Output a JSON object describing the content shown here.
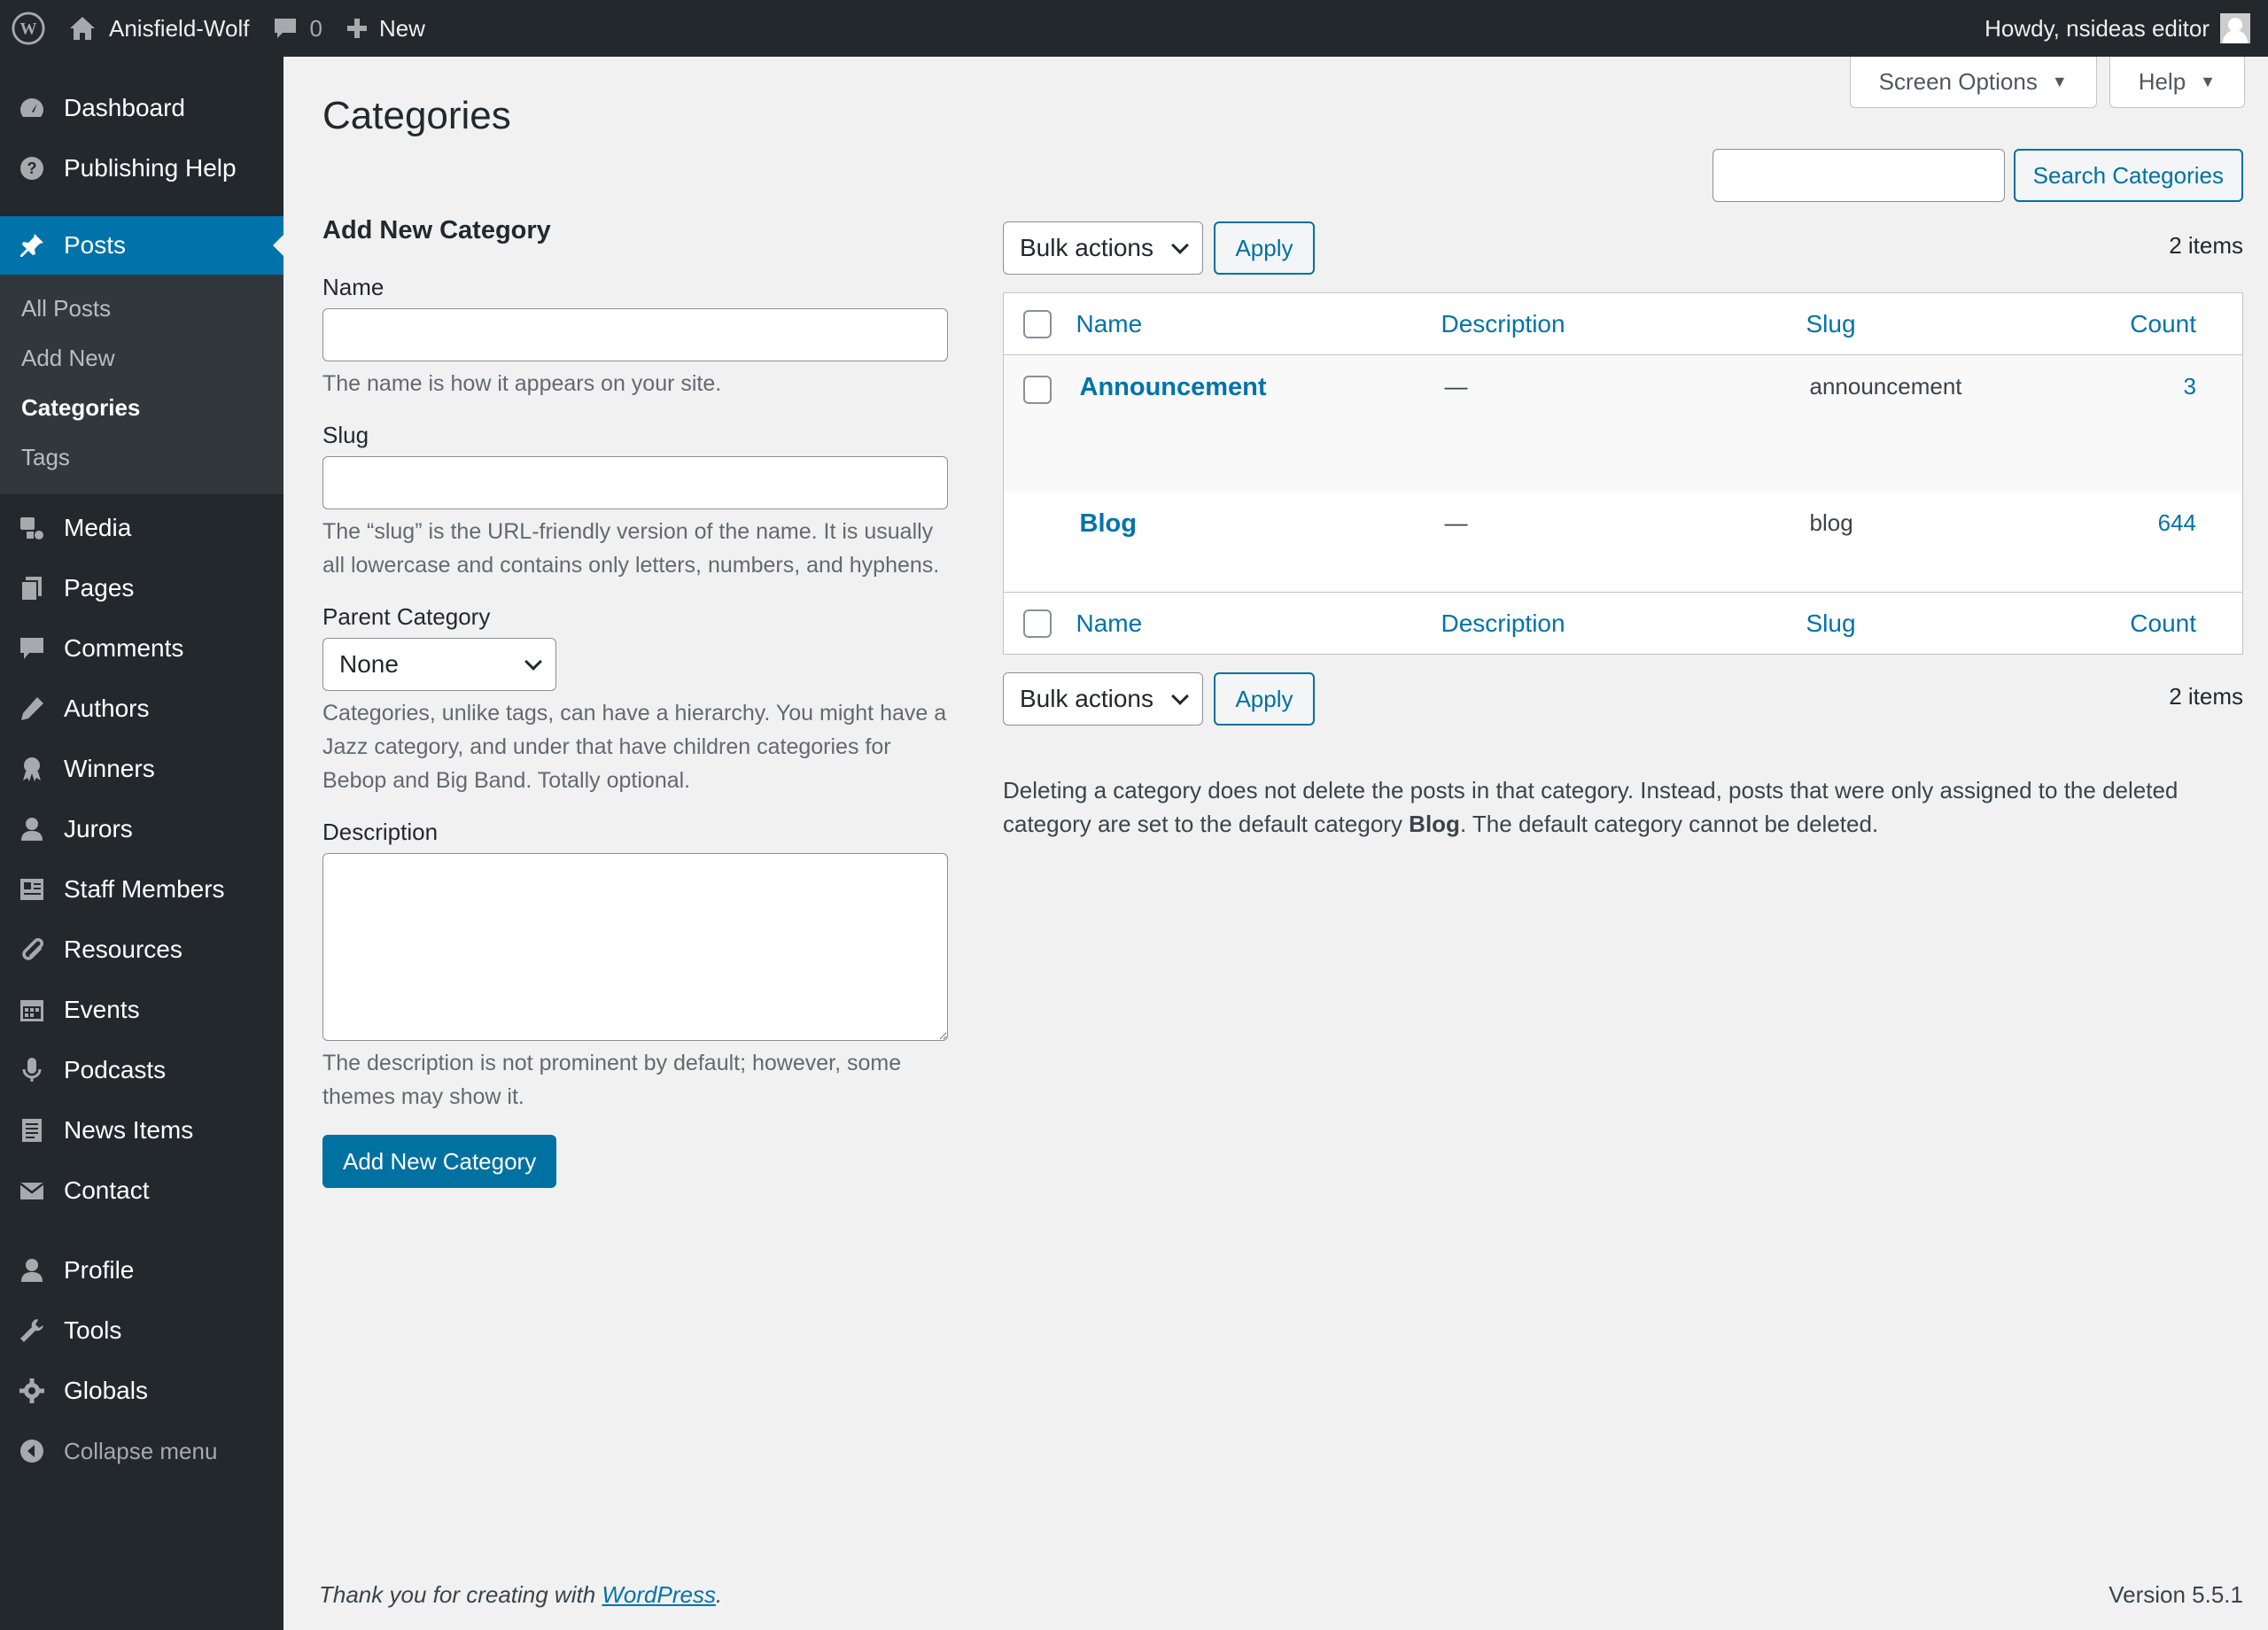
{
  "adminbar": {
    "wp_logo_icon": "wordpress-logo-icon",
    "site_name": "Anisfield-Wolf",
    "comments_count": "0",
    "new_label": "New",
    "howdy": "Howdy, nsideas editor"
  },
  "sidebar": {
    "items_top": [
      {
        "label": "Dashboard",
        "icon": "dashboard-icon"
      },
      {
        "label": "Publishing Help",
        "icon": "question-icon"
      }
    ],
    "posts": {
      "label": "Posts",
      "icon": "pin-icon"
    },
    "posts_sub": [
      {
        "label": "All Posts"
      },
      {
        "label": "Add New"
      },
      {
        "label": "Categories"
      },
      {
        "label": "Tags"
      }
    ],
    "items_mid": [
      {
        "label": "Media",
        "icon": "media-icon"
      },
      {
        "label": "Pages",
        "icon": "pages-icon"
      },
      {
        "label": "Comments",
        "icon": "comment-icon"
      },
      {
        "label": "Authors",
        "icon": "pen-icon"
      },
      {
        "label": "Winners",
        "icon": "award-icon"
      },
      {
        "label": "Jurors",
        "icon": "user-icon"
      },
      {
        "label": "Staff Members",
        "icon": "id-card-icon"
      },
      {
        "label": "Resources",
        "icon": "paperclip-icon"
      },
      {
        "label": "Events",
        "icon": "calendar-icon"
      },
      {
        "label": "Podcasts",
        "icon": "microphone-icon"
      },
      {
        "label": "News Items",
        "icon": "document-icon"
      },
      {
        "label": "Contact",
        "icon": "email-icon"
      }
    ],
    "items_bottom": [
      {
        "label": "Profile",
        "icon": "user-icon"
      },
      {
        "label": "Tools",
        "icon": "wrench-icon"
      },
      {
        "label": "Globals",
        "icon": "gear-icon"
      }
    ],
    "collapse": "Collapse menu"
  },
  "screen_meta": {
    "screen_options": "Screen Options",
    "help": "Help"
  },
  "page_title": "Categories",
  "search": {
    "button": "Search Categories",
    "placeholder": ""
  },
  "form": {
    "heading": "Add New Category",
    "name_label": "Name",
    "name_help": "The name is how it appears on your site.",
    "slug_label": "Slug",
    "slug_help": "The “slug” is the URL-friendly version of the name. It is usually all lowercase and contains only letters, numbers, and hyphens.",
    "parent_label": "Parent Category",
    "parent_value": "None",
    "parent_help": "Categories, unlike tags, can have a hierarchy. You might have a Jazz category, and under that have children categories for Bebop and Big Band. Totally optional.",
    "description_label": "Description",
    "description_help": "The description is not prominent by default; however, some themes may show it.",
    "submit": "Add New Category"
  },
  "table": {
    "bulk_actions": "Bulk actions",
    "apply": "Apply",
    "items_count": "2 items",
    "columns": {
      "name": "Name",
      "description": "Description",
      "slug": "Slug",
      "count": "Count"
    },
    "rows": [
      {
        "name": "Announcement",
        "description": "—",
        "slug": "announcement",
        "count": "3"
      },
      {
        "name": "Blog",
        "description": "—",
        "slug": "blog",
        "count": "644"
      }
    ]
  },
  "note": {
    "before": "Deleting a category does not delete the posts in that category. Instead, posts that were only assigned to the deleted category are set to the default category ",
    "bold": "Blog",
    "after": ". The default category cannot be deleted."
  },
  "footer": {
    "thanks_before": "Thank you for creating with ",
    "link": "WordPress",
    "thanks_after": ".",
    "version": "Version 5.5.1"
  }
}
